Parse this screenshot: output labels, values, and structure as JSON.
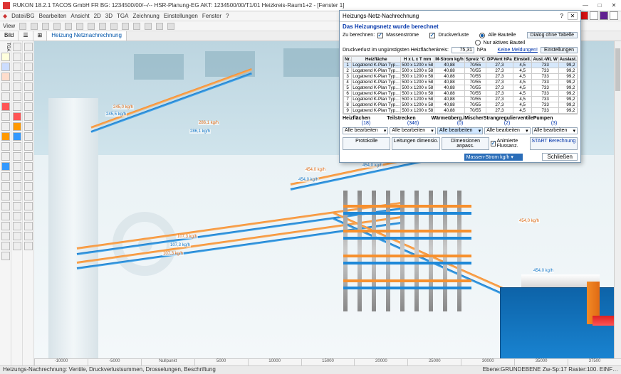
{
  "title": "RUKON 18.2.1  TACOS GmbH FR  BG: 1234500/00/--/--  HSR-Planung-EG  AKT: 1234500/00/T1/01 Heizkreis-Raum1+2 - [Fenster 1]",
  "winctrl": {
    "min": "—",
    "max": "□",
    "close": "✕"
  },
  "menu": [
    "Datei/BG",
    "Bearbeiten",
    "Ansicht",
    "2D",
    "3D",
    "TGA",
    "Zeichnung",
    "Einstellungen",
    "Fenster",
    "?"
  ],
  "toolbar_view": "View",
  "tabs": {
    "bild": "Bild",
    "list": "☰",
    "grid": "⊞",
    "active": "Heizung  Netznachrechnung"
  },
  "ruler": [
    "-10000",
    "-5000",
    "Nullpunkt",
    "5000",
    "10000",
    "15000",
    "20000",
    "25000",
    "30000",
    "35000",
    "37500"
  ],
  "status_left": "Heizungs-Nachrechnung: Ventile, Druckverlustsummen, Drosselungen, Beschriftung",
  "status_right": "Ebene:GRUNDEBENE   Zw-Sp:17   Raster:100.   EINF…",
  "flows": {
    "a": "454,0 kg/h",
    "a2": "454,0 kg/h",
    "a3": "454,0 kg/h",
    "a4": "454,0 kg/h",
    "b": "107,3 kg/h",
    "b2": "107,3 kg/h",
    "b3": "107,3 kg/h",
    "c": "286,1 kg/h",
    "c2": "286,1 kg/h",
    "d": "245,0 kg/h",
    "d2": "245,5 kg/h"
  },
  "dialog": {
    "title": "Heizungs-Netz-Nachrechnung",
    "hint": "Das Heizungsnetz wurde berechnet",
    "calc_label": "Zu berechnen:",
    "mass": "Massenströme",
    "dploss": "Druckverluste",
    "all_parts": "Alle Bauteile",
    "only_active": "Nur aktives Bauteil",
    "dlg_no_table": "Dialog ohne Tabelle",
    "worst_label": "Druckverlust im ungünstigsten Heizflächenkreis:",
    "worst_val": "75,31",
    "worst_unit": "hPa",
    "no_msg": "Keine Meldungen!",
    "settings": "Einstellungen",
    "cols": [
      "Nr.",
      "Heizfläche",
      "H x L x T mm",
      "M-Strom kg/h",
      "Spreiz °C",
      "DPVent hPa",
      "Einstell.",
      "Ausl.-WL W",
      "Auslast. %",
      "↕"
    ],
    "rows": [
      [
        "1",
        "Logatrend K-Plan Typ…",
        "500 x 1200 x 58",
        "40,88",
        "70/55",
        "27,3",
        "4,5",
        "733",
        "99,2",
        ""
      ],
      [
        "2",
        "Logatrend K-Plan Typ…",
        "500 x 1200 x 58",
        "40,88",
        "70/55",
        "27,3",
        "4,5",
        "733",
        "99,2",
        ""
      ],
      [
        "3",
        "Logatrend K-Plan Typ…",
        "500 x 1200 x 58",
        "40,88",
        "70/55",
        "27,3",
        "4,5",
        "733",
        "99,2",
        ""
      ],
      [
        "4",
        "Logatrend K-Plan Typ…",
        "500 x 1200 x 58",
        "40,88",
        "70/55",
        "27,3",
        "4,5",
        "733",
        "99,2",
        ""
      ],
      [
        "5",
        "Logatrend K-Plan Typ…",
        "500 x 1200 x 58",
        "40,88",
        "70/55",
        "27,3",
        "4,5",
        "733",
        "99,2",
        ""
      ],
      [
        "6",
        "Logatrend K-Plan Typ…",
        "500 x 1200 x 58",
        "40,88",
        "70/55",
        "27,3",
        "4,5",
        "733",
        "99,2",
        ""
      ],
      [
        "7",
        "Logatrend K-Plan Typ…",
        "500 x 1200 x 58",
        "40,88",
        "70/55",
        "27,3",
        "4,5",
        "733",
        "99,2",
        ""
      ],
      [
        "8",
        "Logatrend K-Plan Typ…",
        "500 x 1200 x 58",
        "40,88",
        "70/55",
        "27,3",
        "4,5",
        "733",
        "99,2",
        ""
      ],
      [
        "9",
        "Logatrend K-Plan Typ…",
        "500 x 1200 x 58",
        "40,88",
        "70/55",
        "27,3",
        "4,5",
        "733",
        "99,2",
        ""
      ]
    ],
    "sections": [
      "Heizflächen",
      "Teilstrecken",
      "Wärmeüberg./Mischer",
      "Strangregulierventile",
      "Pumpen"
    ],
    "counts": [
      "(18)",
      "(346)",
      "(0)",
      "(2)",
      "(3)"
    ],
    "alle": "Alle bearbeiten",
    "alle_sel": "Alle bearbeiten",
    "btns": {
      "prot": "Protokolle",
      "dim": "Leitungen dimensio.",
      "anp": "Dimensionen anpass."
    },
    "anim": "Animierte Flussanz.",
    "start": "START Berechnung",
    "massflow_dd": "Massen-Strom kg/h",
    "close": "Schließen"
  }
}
